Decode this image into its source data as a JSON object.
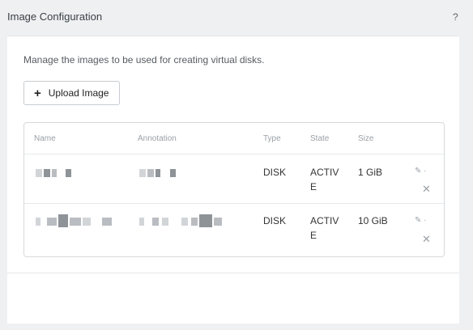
{
  "header": {
    "title": "Image Configuration",
    "help_label": "?"
  },
  "main": {
    "description": "Manage the images to be used for creating virtual disks.",
    "upload_label": "Upload Image",
    "table": {
      "columns": [
        "Name",
        "Annotation",
        "Type",
        "State",
        "Size"
      ],
      "rows": [
        {
          "type": "DISK",
          "state": "ACTIVE",
          "size": "1 GiB"
        },
        {
          "type": "DISK",
          "state": "ACTIVE",
          "size": "10 GiB"
        }
      ]
    }
  },
  "icons": {
    "edit": "pencil-icon",
    "delete": "close-icon",
    "upload": "plus-icon",
    "help": "question-icon"
  }
}
